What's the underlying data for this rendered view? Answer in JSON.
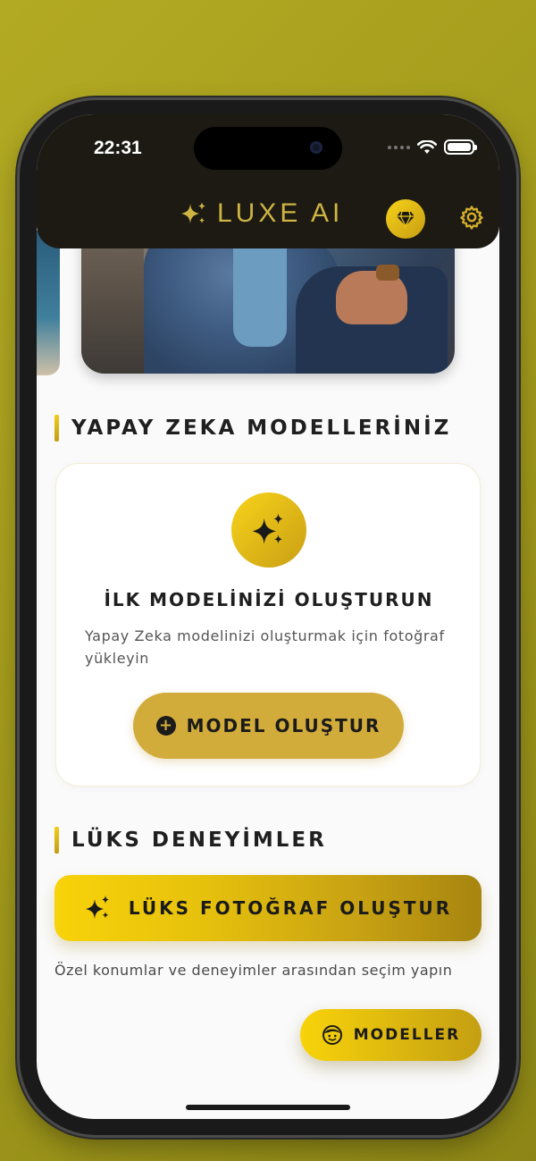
{
  "status_bar": {
    "time": "22:31"
  },
  "header": {
    "brand_name": "LUXE AI",
    "brand_icon": "sparkles-icon",
    "premium_icon": "diamond-icon",
    "settings_icon": "gear-icon"
  },
  "models_section": {
    "title": "YAPAY ZEKA MODELLERİNİZ",
    "empty_card": {
      "icon": "sparkles-icon",
      "title": "İLK MODELİNİZİ OLUŞTURUN",
      "description": "Yapay Zeka modelinizi oluşturmak için fotoğraf yükleyin",
      "button_label": "MODEL OLUŞTUR"
    }
  },
  "luxury_section": {
    "title": "LÜKS DENEYİMLER",
    "button_label": "LÜKS FOTOĞRAF OLUŞTUR",
    "description": "Özel konumlar ve deneyimler arasından seçim yapın"
  },
  "fab": {
    "label": "MODELLER",
    "icon": "face-icon"
  },
  "colors": {
    "accent_gold": "#d2ac3a",
    "gold_light": "#f8d30a",
    "gold_dark": "#a7850f",
    "header_bg": "#1c1a12",
    "brand_text": "#cdb443"
  }
}
